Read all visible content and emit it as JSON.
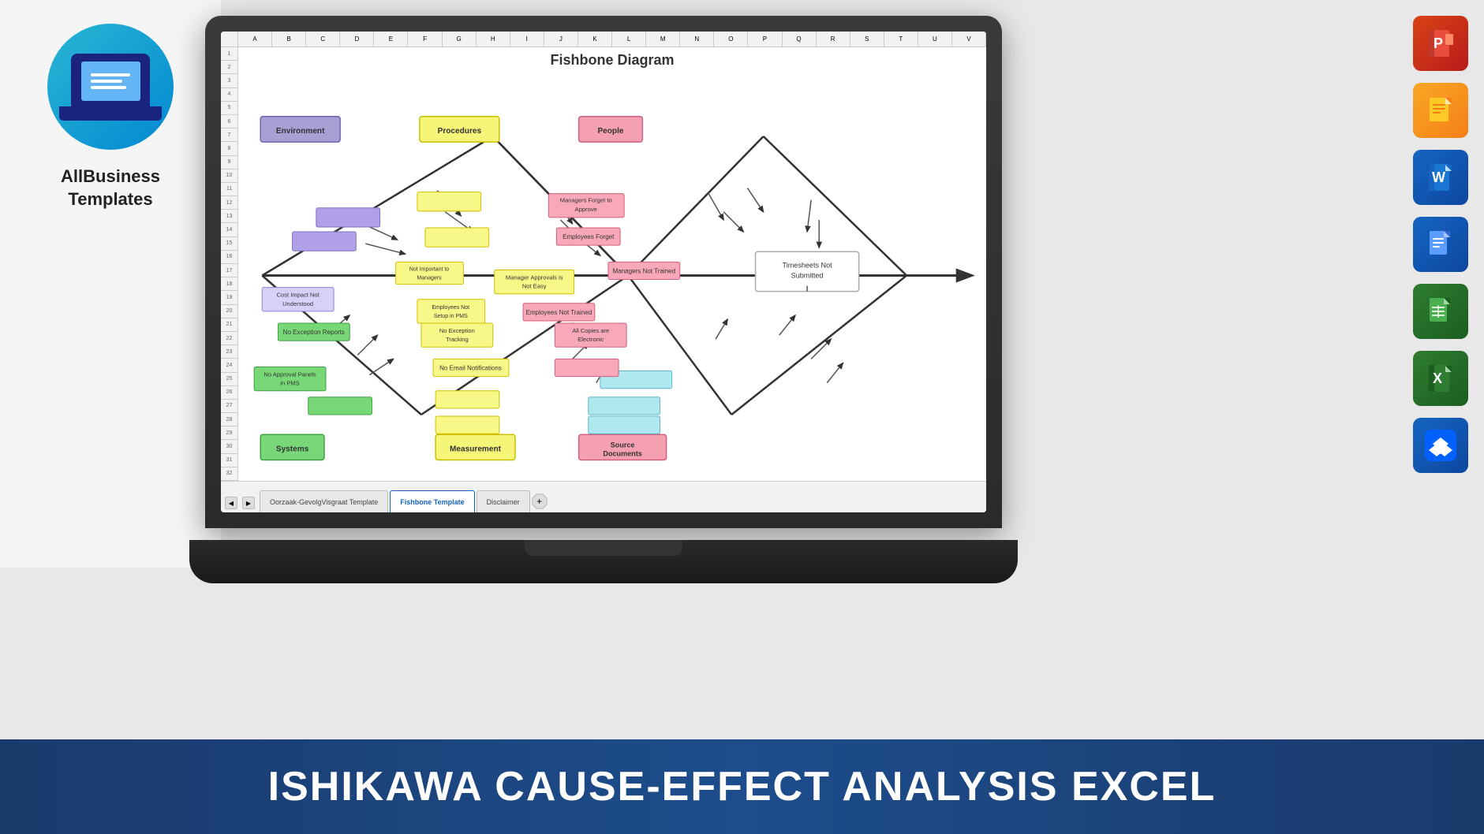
{
  "brand": {
    "name": "AllBusiness\nTemplates",
    "logo_alt": "AllBusiness Templates Logo"
  },
  "diagram": {
    "title": "Fishbone Diagram",
    "categories": {
      "environment": "Environment",
      "procedures": "Procedures",
      "people": "People",
      "systems": "Systems",
      "measurement": "Measurement",
      "source_documents": "Source Documents"
    },
    "boxes": {
      "managers_forget_approve": "Managers Forget to Approve",
      "employees_forget": "Employees Forget",
      "managers_not_trained": "Managers Not Trained",
      "manager_approvals_not_easy": "Manager Approvals is Not Easy",
      "not_important_to_managers": "Not Important to Managers",
      "employees_not_trained": "Employees Not Trained",
      "employees_not_setup_pms": "Employees Not Setup in PMS",
      "cost_impact_not_understood": "Cost Impact Not Understood",
      "no_exception_reports": "No Exception Reports",
      "no_exception_tracking": "No Exception Tracking",
      "no_email_notifications": "No Email Notifications",
      "all_copies_electronic": "All Copies are Electronic",
      "no_approval_panels_pms": "No Approval Panels in PMS",
      "timesheets_not_submitted": "Timesheets Not Submitted"
    }
  },
  "tabs": {
    "tab1": "Oorzaak-GevolgVisgraat Template",
    "tab2": "Fishbone Template",
    "tab3": "Disclaimer",
    "add": "+"
  },
  "banner": {
    "text": "ISHIKAWA CAUSE-EFFECT ANALYSIS  EXCEL"
  },
  "apps": [
    {
      "name": "PowerPoint",
      "icon": "ppt",
      "color": "#c0392b"
    },
    {
      "name": "Google Slides",
      "icon": "slides",
      "color": "#f39c12"
    },
    {
      "name": "Word",
      "icon": "word",
      "color": "#1565c0"
    },
    {
      "name": "Google Docs",
      "icon": "docs",
      "color": "#1565c0"
    },
    {
      "name": "Google Sheets",
      "icon": "sheets",
      "color": "#2e7d32"
    },
    {
      "name": "Excel",
      "icon": "excel",
      "color": "#2e7d32"
    },
    {
      "name": "Dropbox",
      "icon": "dropbox",
      "color": "#1565c0"
    }
  ],
  "column_headers": [
    "A",
    "B",
    "C",
    "D",
    "E",
    "F",
    "G",
    "H",
    "I",
    "J",
    "K",
    "L",
    "M",
    "N",
    "O",
    "P",
    "Q",
    "R",
    "S",
    "T",
    "U",
    "V"
  ]
}
